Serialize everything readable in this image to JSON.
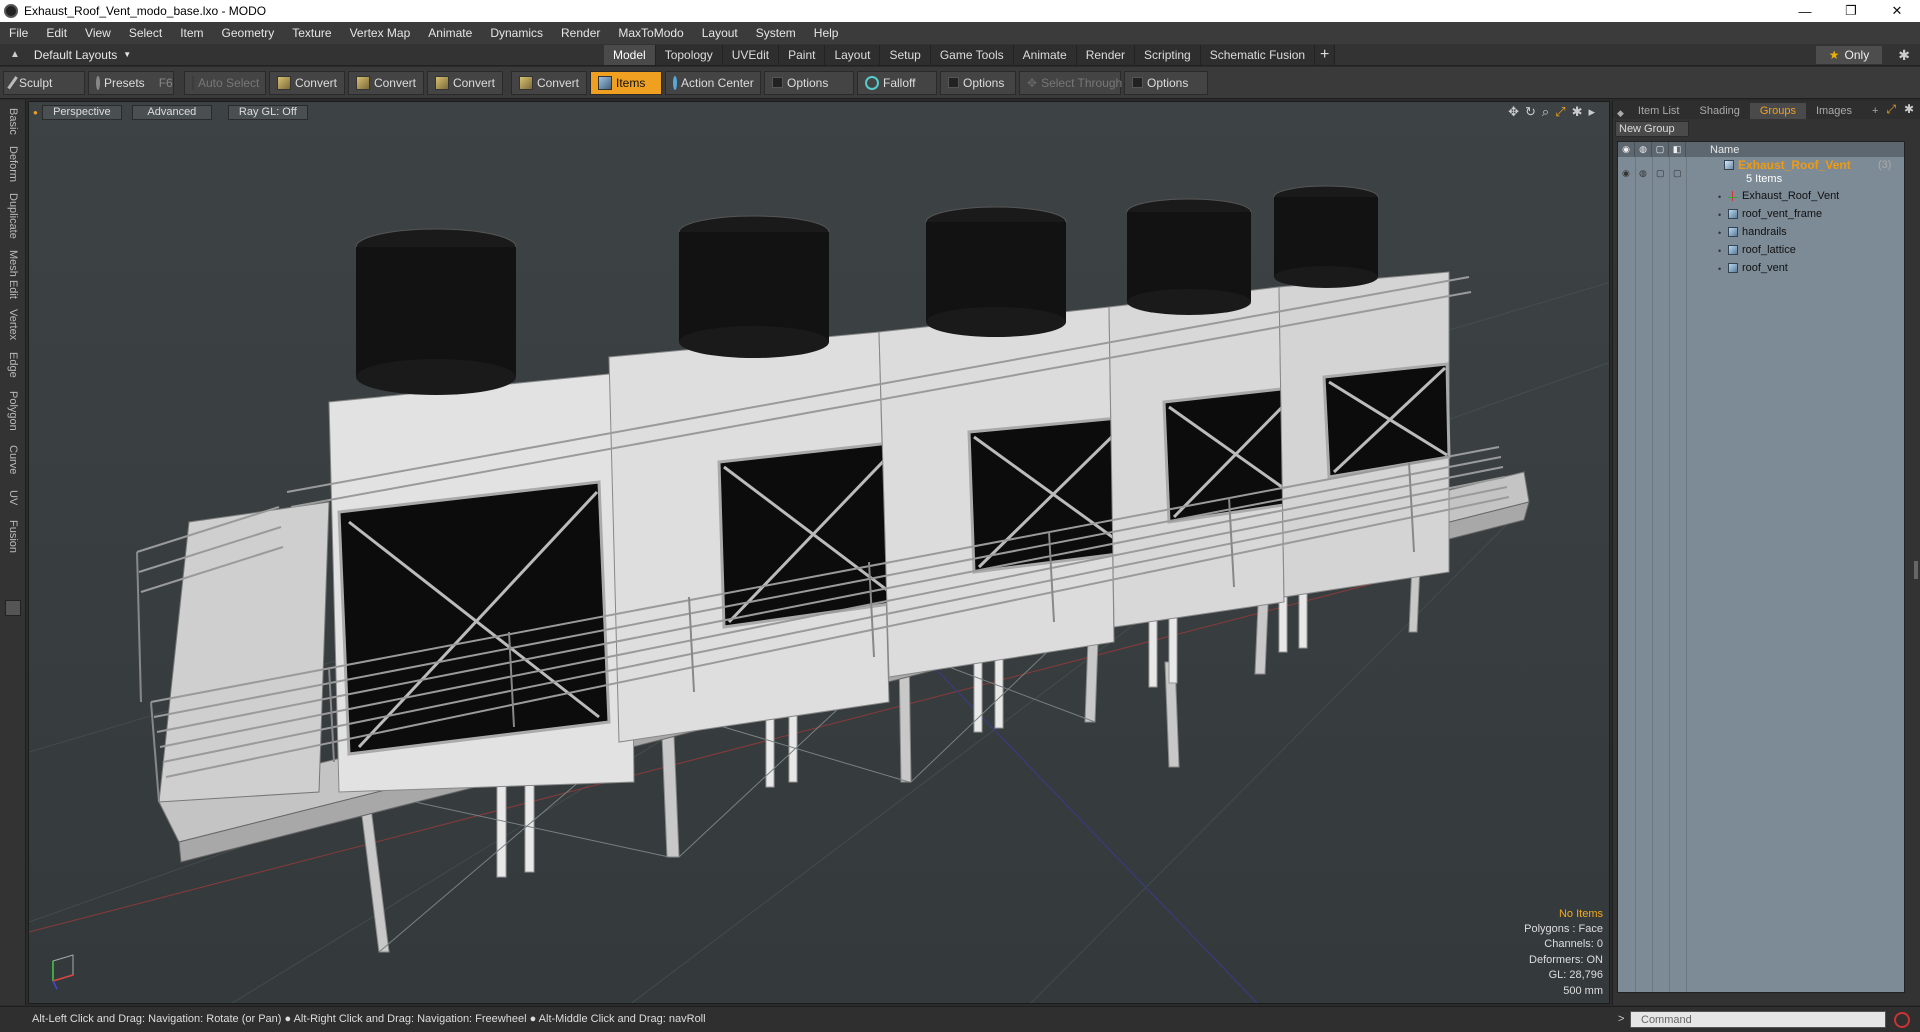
{
  "window": {
    "title": "Exhaust_Roof_Vent_modo_base.lxo - MODO",
    "minimize": "—",
    "maximize": "❐",
    "close": "✕"
  },
  "menu": [
    "File",
    "Edit",
    "View",
    "Select",
    "Item",
    "Geometry",
    "Texture",
    "Vertex Map",
    "Animate",
    "Dynamics",
    "Render",
    "MaxToModo",
    "Layout",
    "System",
    "Help"
  ],
  "layout": {
    "selector": "Default Layouts",
    "tabs": [
      "Model",
      "Topology",
      "UVEdit",
      "Paint",
      "Layout",
      "Setup",
      "Game Tools",
      "Animate",
      "Render",
      "Scripting",
      "Schematic Fusion"
    ],
    "active_tab": "Model",
    "add_tab": "+",
    "only_label": "Only"
  },
  "toolbar": {
    "sculpt": "Sculpt",
    "presets": "Presets",
    "presets_key": "F6",
    "auto_select": "Auto Select",
    "convert1": "Convert",
    "convert2": "Convert",
    "convert3": "Convert",
    "convert4": "Convert",
    "items": "Items",
    "action_center": "Action Center",
    "options1": "Options",
    "falloff": "Falloff",
    "options2": "Options",
    "select_through": "Select Through",
    "options3": "Options"
  },
  "left_tabs": [
    "Basic",
    "Deform",
    "Duplicate",
    "Mesh Edit",
    "Vertex",
    "Edge",
    "Polygon",
    "Curve",
    "UV",
    "Fusion"
  ],
  "viewport": {
    "view_mode": "Perspective",
    "advanced": "Advanced",
    "raygl": "Ray GL: Off",
    "info": {
      "selection": "No Items",
      "polygons": "Polygons : Face",
      "channels": "Channels: 0",
      "deformers": "Deformers: ON",
      "gl": "GL: 28,796",
      "scale": "500 mm"
    }
  },
  "right_panel": {
    "tabs": [
      "Item List",
      "Shading",
      "Groups",
      "Images"
    ],
    "active_tab": "Groups",
    "add_tab": "+",
    "new_group": "New Group",
    "column_name": "Name",
    "group": {
      "name": "Exhaust_Roof_Vent",
      "count": "(3)",
      "items_label": "5 Items",
      "children": [
        {
          "name": "Exhaust_Roof_Vent",
          "icon": "locator-icon"
        },
        {
          "name": "roof_vent_frame",
          "icon": "mesh-icon"
        },
        {
          "name": "handrails",
          "icon": "mesh-icon"
        },
        {
          "name": "roof_lattice",
          "icon": "mesh-icon"
        },
        {
          "name": "roof_vent",
          "icon": "mesh-icon"
        }
      ]
    }
  },
  "statusbar": {
    "hint": "Alt-Left Click and Drag: Navigation: Rotate (or Pan) ● Alt-Right Click and Drag: Navigation: Freewheel ● Alt-Middle Click and Drag: navRoll",
    "command_placeholder": "Command",
    "command_arrow": ">"
  },
  "colors": {
    "accent": "#f0a020",
    "viewport_bg": "#394042",
    "group_panel_bg": "#7d8b96"
  }
}
